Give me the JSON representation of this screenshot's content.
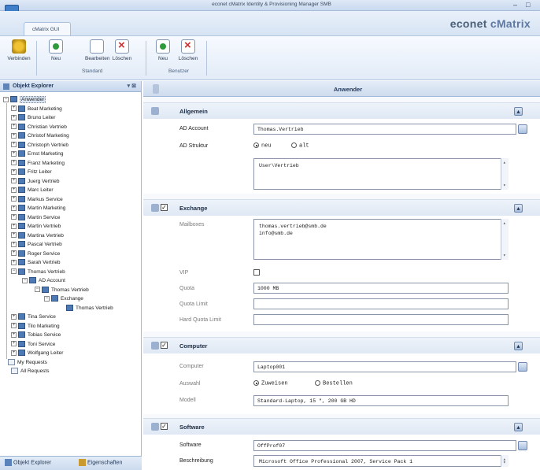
{
  "window": {
    "title": "econet cMatrix Identity & Provisioning Manager SMB",
    "controls": [
      "–",
      "□"
    ]
  },
  "ribbon": {
    "tab": "cMatrix GUI",
    "brand_a": "econet",
    "brand_b": "cMatrix",
    "buttons": {
      "connect": "Verbinden",
      "new1": "Neu",
      "edit": "Bearbeiten",
      "delete1": "Löschen",
      "new2": "Neu",
      "delete2": "Löschen"
    },
    "groups": {
      "standard": "Standard",
      "benutzer": "Benutzer"
    }
  },
  "explorer": {
    "title": "Objekt Explorer",
    "pin": "▾ ⊠",
    "root": "Anwender",
    "users": [
      "Beat Marketing",
      "Bruno Leiter",
      "Christian Vertrieb",
      "Christof Marketing",
      "Christoph Vertrieb",
      "Ernst Marketing",
      "Franz Marketing",
      "Fritz Leiter",
      "Juerg Vertrieb",
      "Marc Leiter",
      "Markus Service",
      "Martin Marketing",
      "Martin Service",
      "Martin Vertrieb",
      "Martina Vertrieb",
      "Pascal Vertrieb",
      "Roger Service",
      "Sarah Vertrieb",
      "Thomas Vertrieb"
    ],
    "sub": [
      "AD Account",
      "Thomas Vertrieb",
      "Exchange",
      "Thomas Vertrieb"
    ],
    "users_after": [
      "Tina Service",
      "Tilo Marketing",
      "Tobias Service",
      "Toni Service",
      "Wolfgang Leiter"
    ],
    "requests": [
      "My Requests",
      "All Requests"
    ],
    "footer": {
      "tab1": "Objekt Explorer",
      "tab2": "Eigenschaften"
    }
  },
  "main": {
    "title": "Anwender",
    "allgemein": {
      "title": "Allgemein",
      "ad_account_label": "AD Account",
      "ad_account_value": "Thomas.Vertrieb",
      "ad_struktur_label": "AD Struktur",
      "radio_new": "neu",
      "radio_old": "alt",
      "path_value": "User\\Vertrieb"
    },
    "exchange": {
      "title": "Exchange",
      "mailboxes_label": "Mailboxes",
      "mailboxes": [
        "thomas.vertrieb@smb.de",
        "info@smb.de"
      ],
      "vip_label": "VIP",
      "quota_label": "Quota",
      "quota_value": "1000 MB",
      "quota_limit_label": "Quota Limit",
      "quota_limit_value": "",
      "hard_quota_label": "Hard Quota Limit",
      "hard_quota_value": ""
    },
    "computer": {
      "title": "Computer",
      "computer_label": "Computer",
      "computer_value": "Laptop001",
      "auswahl_label": "Auswahl",
      "radio_assign": "Zuweisen",
      "radio_order": "Bestellen",
      "modell_label": "Modell",
      "modell_value": "Standard-Laptop, 15 \", 200 GB HD"
    },
    "software": {
      "title": "Software",
      "software_label": "Software",
      "software_value": "OffProf07",
      "beschreibung_label": "Beschreibung",
      "beschreibung_value": "Microsoft Office Professional 2007, Service Pack 1"
    },
    "check_mark": "✓",
    "collapse_symbol": "▴"
  }
}
